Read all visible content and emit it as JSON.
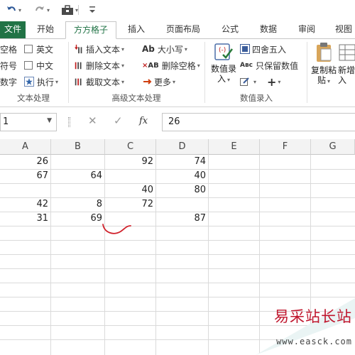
{
  "tabs": [
    "文件",
    "开始",
    "方方格子",
    "插入",
    "页面布局",
    "公式",
    "数据",
    "审阅",
    "视图"
  ],
  "ribbon": {
    "text_group": {
      "items": [
        "空格",
        "英文",
        "符号",
        "中文",
        "数字",
        "执行"
      ],
      "label": "文本处理"
    },
    "advanced_group": {
      "items": [
        "插入文本",
        "删除文本",
        "截取文本",
        "大小写",
        "删除空格",
        "更多"
      ],
      "label": "高级文本处理"
    },
    "number_group": {
      "big_button_line1": "数值录",
      "big_button_line2": "入",
      "items": [
        "四舍五入",
        "只保留数值"
      ],
      "label": "数值录入"
    },
    "copy_group": {
      "copy_line1": "复制粘",
      "copy_line2": "贴",
      "new_line1": "新增",
      "new_line2": "入"
    }
  },
  "formula_bar": {
    "name_box": "1",
    "fx": "fx",
    "value": "26"
  },
  "columns": [
    "A",
    "B",
    "C",
    "D",
    "E",
    "F",
    "G"
  ],
  "rows": [
    [
      "26",
      "",
      "92",
      "74"
    ],
    [
      "67",
      "64",
      "",
      "40"
    ],
    [
      "",
      "",
      "40",
      "80"
    ],
    [
      "42",
      "8",
      "72",
      ""
    ],
    [
      "31",
      "69",
      "",
      "87"
    ]
  ],
  "watermark": {
    "title": "易采站长站",
    "url": "www.easck.com"
  },
  "colors": {
    "excel_green": "#217346",
    "watermark_red": "#c0172e",
    "mark_red": "#d0202a"
  }
}
